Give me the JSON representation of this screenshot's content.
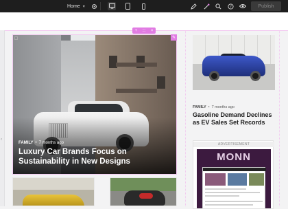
{
  "toolbar": {
    "page_name": "Home",
    "publish_label": "Publish",
    "icons": [
      "chevron-down-icon",
      "gear-icon",
      "desktop-icon",
      "tablet-icon",
      "mobile-icon",
      "pencil-icon",
      "magic-icon",
      "search-icon",
      "help-icon",
      "eye-icon"
    ]
  },
  "section_handle": {
    "add": "+",
    "drag": ":::",
    "close": "×"
  },
  "featured": {
    "category": "FAMILY",
    "time": "7 months ago",
    "title": "Luxury Car Brands Focus on Sustainability in New Designs"
  },
  "side_article": {
    "category": "FAMILY",
    "time": "7 months ago",
    "title": "Gasoline Demand Declines as EV Sales Set Records"
  },
  "ad": {
    "label": "ADVERTISEMENT",
    "logo": "MONN"
  },
  "colors": {
    "accent": "#e17ce3",
    "toolbar_bg": "#1e1e1e",
    "canvas_bg": "#f3f3f4"
  }
}
